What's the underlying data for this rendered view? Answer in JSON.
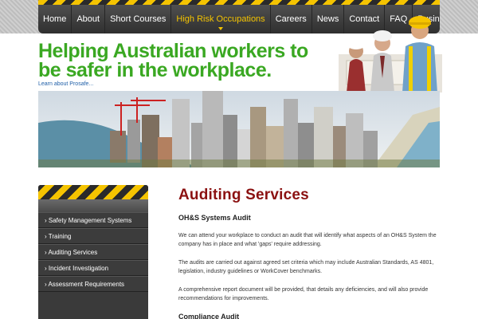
{
  "nav": {
    "items": [
      {
        "label": "Home"
      },
      {
        "label": "About"
      },
      {
        "label": "Short Courses"
      },
      {
        "label": "High Risk Occupations",
        "active": true
      },
      {
        "label": "Careers"
      },
      {
        "label": "News"
      },
      {
        "label": "Contact"
      },
      {
        "label": "FAQ"
      },
      {
        "label": "Business Partners"
      }
    ]
  },
  "hero": {
    "line1": "Helping Australian workers to",
    "line2": "be safer in the workplace.",
    "link": "Learn about Prosafe..."
  },
  "sidebar": {
    "items": [
      {
        "label": "› Safety Management Systems"
      },
      {
        "label": "› Training"
      },
      {
        "label": "› Auditing Services"
      },
      {
        "label": "› Incident Investigation"
      },
      {
        "label": "› Assessment Requirements"
      }
    ]
  },
  "content": {
    "title": "Auditing Services",
    "section1_title": "OH&S Systems Audit",
    "p1": "We can attend your workplace to conduct an audit that will identify what aspects of an OH&S System the company has in place and what 'gaps' require addressing.",
    "p2": "The audits are carried out against agreed set criteria which may include Australian Standards, AS 4801, legislation, industry guidelines or WorkCover benchmarks.",
    "p3": "A comprehensive report document will be provided, that details any deficiencies, and will also provide recommendations for improvements.",
    "section2_title": "Compliance Audit"
  },
  "colors": {
    "accent_yellow": "#f5c400",
    "hero_green": "#3aa822",
    "title_red": "#8b1111"
  }
}
